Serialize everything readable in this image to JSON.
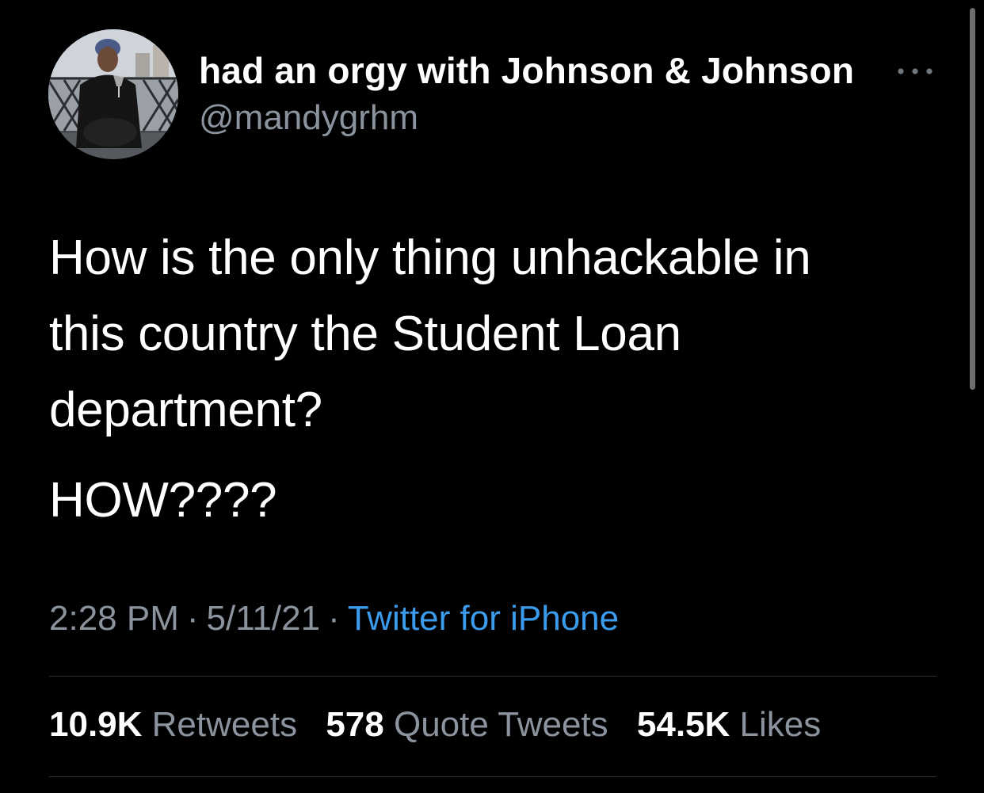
{
  "author": {
    "display_name": "had an orgy with Johnson & Johnson",
    "handle": "@mandygrhm",
    "avatar_icon": "profile-photo"
  },
  "more_icon": "ellipsis-icon",
  "tweet": {
    "lines": [
      "How is the only thing unhackable in",
      "this country the Student Loan",
      "department?"
    ],
    "second_paragraph": "HOW????"
  },
  "meta": {
    "time": "2:28 PM",
    "separator": "·",
    "date": "5/11/21",
    "source": "Twitter for iPhone"
  },
  "stats": {
    "retweets_count": "10.9K",
    "retweets_label": "Retweets",
    "quotes_count": "578",
    "quotes_label": "Quote Tweets",
    "likes_count": "54.5K",
    "likes_label": "Likes"
  },
  "colors": {
    "background": "#000000",
    "primary_text": "#ffffff",
    "secondary_text": "#8b949e",
    "link": "#3b9ced",
    "divider": "#2f3336"
  }
}
